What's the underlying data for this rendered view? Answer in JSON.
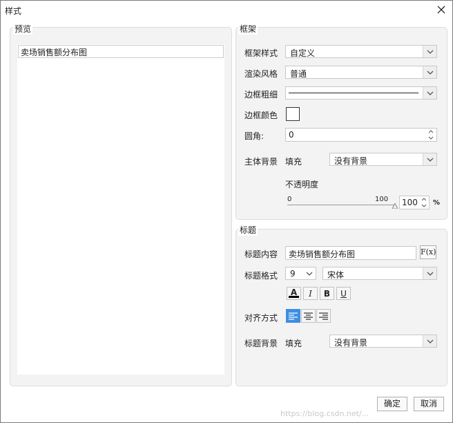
{
  "window": {
    "title": "样式"
  },
  "preview": {
    "group_label": "预览",
    "chart_title": "卖场销售额分布图"
  },
  "frame": {
    "group_label": "框架",
    "style_label": "框架样式",
    "style_value": "自定义",
    "render_label": "渲染风格",
    "render_value": "普通",
    "border_width_label": "边框粗细",
    "border_color_label": "边框颜色",
    "radius_label": "圆角:",
    "radius_value": "0",
    "background_label": "主体背景",
    "fill_label": "填充",
    "background_value": "没有背景",
    "opacity_label": "不透明度",
    "slider_min": "0",
    "slider_max": "100",
    "opacity_value": "100",
    "opacity_unit": "%",
    "opacity_level": 1.0
  },
  "title": {
    "group_label": "标题",
    "content_label": "标题内容",
    "content_value": "卖场销售额分布图",
    "fx_label": "F(x)",
    "format_label": "标题格式",
    "font_size": "9",
    "font_name": "宋体",
    "bold": "B",
    "italic": "I",
    "underline": "U",
    "align_label": "对齐方式",
    "background_label": "标题背景",
    "fill_label": "填充",
    "background_value": "没有背景"
  },
  "buttons": {
    "ok": "确定",
    "cancel": "取消"
  },
  "icons": {
    "close": "close-icon",
    "dropdown": "chevron-down-icon",
    "spin_up": "chevron-up-icon",
    "spin_down": "chevron-down-icon"
  },
  "colors": {
    "accent": "#3d8ee3",
    "font_color_bar": "#000000",
    "border_color_swatch": "#ffffff"
  },
  "watermark": "https://blog.csdn.net/..."
}
